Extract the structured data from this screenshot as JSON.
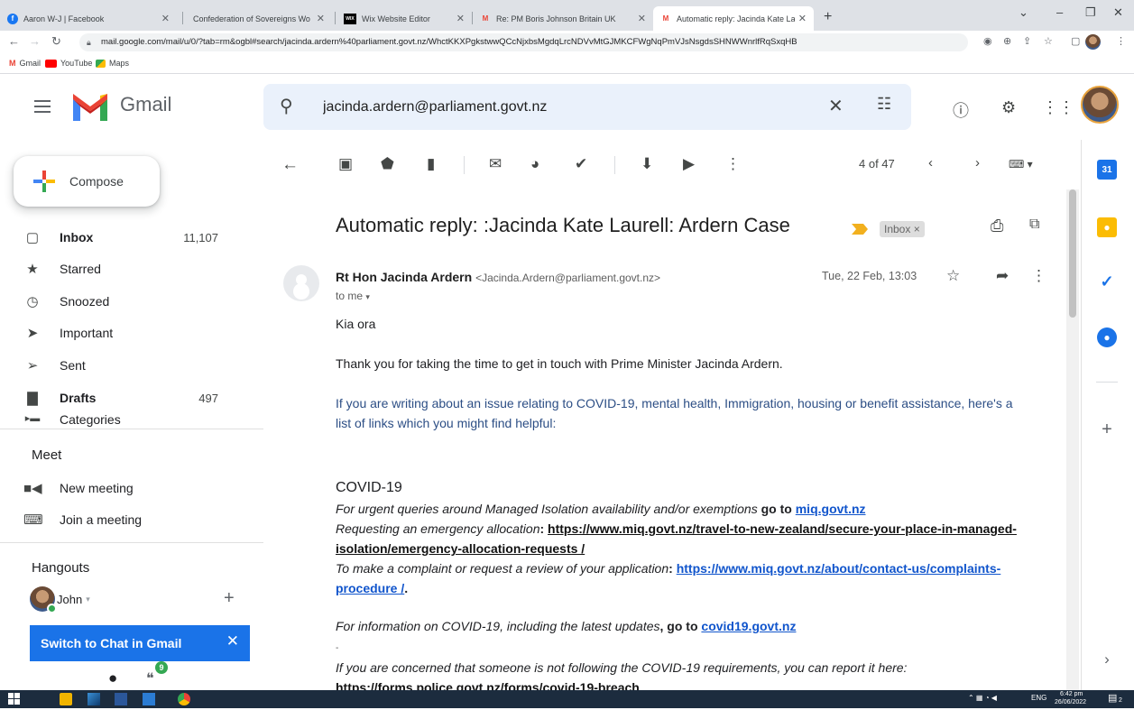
{
  "browser": {
    "tabs": [
      {
        "title": "Aaron W-J | Facebook",
        "active": false
      },
      {
        "title": "Confederation of Sovereigns Wo",
        "active": false
      },
      {
        "title": "Wix Website Editor",
        "active": false
      },
      {
        "title": "Re: PM Boris Johnson Britain UK",
        "active": false
      },
      {
        "title": "Automatic reply: Jacinda Kate La",
        "active": true
      }
    ],
    "url": "mail.google.com/mail/u/0/?tab=rm&ogbl#search/jacinda.ardern%40parliament.govt.nz/WhctKKXPgkstwwQCcNjxbsMgdqLrcNDVvMtGJMKCFWgNqPmVJsNsgdsSHNWWnrlfRqSxqHB",
    "bookmarks": [
      "Gmail",
      "YouTube",
      "Maps"
    ]
  },
  "gmail": {
    "logo_text": "Gmail",
    "search_value": "jacinda.ardern@parliament.govt.nz",
    "compose_label": "Compose",
    "nav": [
      {
        "label": "Inbox",
        "count": "11,107",
        "bold": true
      },
      {
        "label": "Starred",
        "count": ""
      },
      {
        "label": "Snoozed",
        "count": ""
      },
      {
        "label": "Important",
        "count": ""
      },
      {
        "label": "Sent",
        "count": ""
      },
      {
        "label": "Drafts",
        "count": "497",
        "bold": true
      },
      {
        "label": "Categories",
        "count": ""
      }
    ],
    "meet": {
      "title": "Meet",
      "new_meeting": "New meeting",
      "join_meeting": "Join a meeting"
    },
    "hangouts": {
      "title": "Hangouts",
      "user": "John",
      "switch_label": "Switch to Chat in Gmail",
      "badge": "9"
    },
    "pager": "4 of 47"
  },
  "message": {
    "subject": "Automatic reply: :Jacinda Kate Laurell: Ardern Case",
    "label": "Inbox",
    "label_close": "×",
    "sender_name": "Rt Hon Jacinda Ardern",
    "sender_email": "<Jacinda.Ardern@parliament.govt.nz>",
    "to": "to me",
    "date": "Tue, 22 Feb, 13:03",
    "greeting": "Kia ora",
    "thanks": "Thank you for taking the time to get in touch with Prime Minister Jacinda Ardern.",
    "intro_1": " If you are writing about an issue relating to COVID-19, mental health, Immigration, housing or benefit assistance, here's a",
    "intro_2": "list of links which you might find helpful:",
    "covid_heading": "COVID-19",
    "urgent_text": "For urgent queries around Managed Isolation availability and/or exemptions",
    "go_to": " go to ",
    "miq_link": "miq.govt.nz",
    "emergency_text": "Requesting an emergency allocation",
    "colon": ": ",
    "emergency_link_1": "https://www.miq.govt.nz/travel-to-new-zealand/secure-your-place-in-managed-",
    "emergency_link_2": "isolation/emergency-allocation-requests /",
    "complaint_text": "To make a complaint or request a review of your application",
    "complaint_link_1": "https://www.miq.govt.nz/about/contact-us/complaints-",
    "complaint_link_2": "procedure /",
    "period": ".",
    "info_text": "For information on COVID-19, including the latest updates",
    "comma_goto": ", go to ",
    "covid_link": "covid19.govt.nz",
    "dash": "-",
    "concern_text": "If you are concerned that someone is not following the COVID-19 requirements, you can report it here:",
    "concern_link": "https://forms.police.govt.nz/forms/covid-19-breach"
  },
  "taskbar": {
    "lang": "ENG",
    "time": "6:42 pm",
    "date": "26/06/2022",
    "notif": "2"
  },
  "colors": {
    "accent": "#1a73e8",
    "search_bg": "#eaf1fb",
    "important": "#f2b01e"
  }
}
